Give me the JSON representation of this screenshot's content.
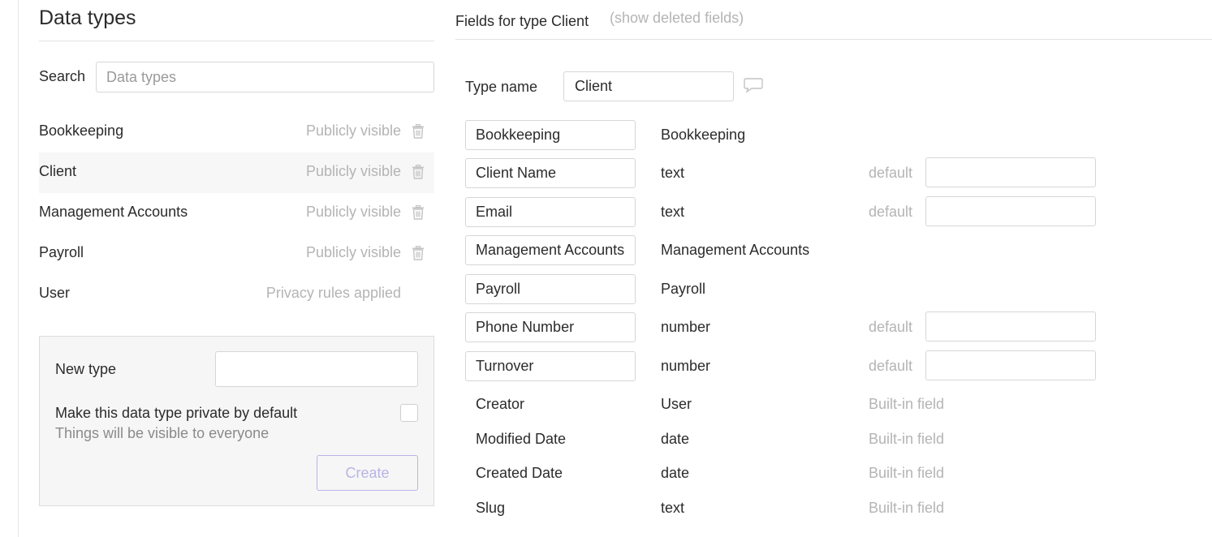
{
  "left": {
    "title": "Data types",
    "search_label": "Search",
    "search_placeholder": "Data types",
    "types": [
      {
        "name": "Bookkeeping",
        "visibility": "Publicly visible",
        "trash": true,
        "selected": false
      },
      {
        "name": "Client",
        "visibility": "Publicly visible",
        "trash": true,
        "selected": true
      },
      {
        "name": "Management Accounts",
        "visibility": "Publicly visible",
        "trash": true,
        "selected": false
      },
      {
        "name": "Payroll",
        "visibility": "Publicly visible",
        "trash": true,
        "selected": false
      },
      {
        "name": "User",
        "visibility": "Privacy rules applied",
        "trash": false,
        "selected": false
      }
    ],
    "new_type": {
      "label": "New type",
      "private_label": "Make this data type private by default",
      "private_hint": "Things will be visible to everyone",
      "create_label": "Create"
    }
  },
  "right": {
    "fields_title": "Fields for type Client",
    "show_deleted": "(show deleted fields)",
    "type_name_label": "Type name",
    "type_name_value": "Client",
    "fields": [
      {
        "name": "Bookkeeping",
        "type": "Bookkeeping",
        "editable": true,
        "default": false,
        "builtin": false
      },
      {
        "name": "Client Name",
        "type": "text",
        "editable": true,
        "default": true,
        "builtin": false
      },
      {
        "name": "Email",
        "type": "text",
        "editable": true,
        "default": true,
        "builtin": false
      },
      {
        "name": "Management Accounts",
        "type": "Management Accounts",
        "editable": true,
        "default": false,
        "builtin": false
      },
      {
        "name": "Payroll",
        "type": "Payroll",
        "editable": true,
        "default": false,
        "builtin": false
      },
      {
        "name": "Phone Number",
        "type": "number",
        "editable": true,
        "default": true,
        "builtin": false
      },
      {
        "name": "Turnover",
        "type": "number",
        "editable": true,
        "default": true,
        "builtin": false
      },
      {
        "name": "Creator",
        "type": "User",
        "editable": false,
        "default": false,
        "builtin": true
      },
      {
        "name": "Modified Date",
        "type": "date",
        "editable": false,
        "default": false,
        "builtin": true
      },
      {
        "name": "Created Date",
        "type": "date",
        "editable": false,
        "default": false,
        "builtin": true
      },
      {
        "name": "Slug",
        "type": "text",
        "editable": false,
        "default": false,
        "builtin": true
      }
    ],
    "default_label": "default",
    "builtin_label": "Built-in field"
  },
  "colors": {
    "muted_text": "#b4b4b4",
    "accent_disabled": "#b9b4e6",
    "selected_row": "#f7f7f7"
  },
  "icons": {
    "trash": "trash-icon",
    "comment": "comment-icon"
  }
}
